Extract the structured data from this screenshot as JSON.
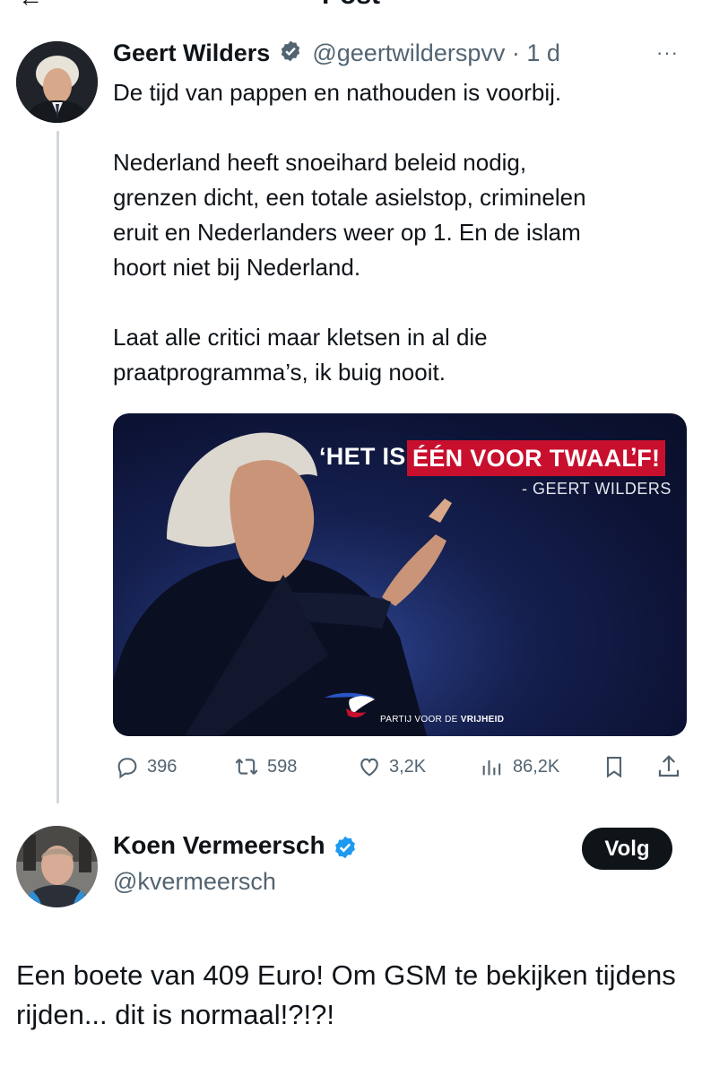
{
  "header": {
    "title": "Post"
  },
  "tweet": {
    "author_name": "Geert Wilders",
    "handle": "@geertwilderspvv",
    "separator": "·",
    "time": "1 d",
    "more": "···",
    "lines": [
      "De tijd van pappen en nathouden is voorbij.",
      "",
      "Nederland heeft snoeihard beleid nodig,",
      "grenzen dicht, een totale asielstop, criminelen",
      "eruit en Nederlanders weer op 1. En de islam",
      "hoort niet bij Nederland.",
      "",
      "Laat alle critici maar kletsen in al die",
      "praatprogramma’s, ik buig nooit."
    ],
    "media": {
      "quote_prefix": "‘HET IS",
      "quote_highlight": "ÉÉN VOOR TWAALF!",
      "quote_suffix": "’",
      "quote_author": "- GEERT WILDERS",
      "party_prefix": "PARTIJ VOOR DE",
      "party_bold": "VRIJHEID",
      "highlight_color": "#c8102e"
    },
    "actions": {
      "replies": "396",
      "reposts": "598",
      "likes": "3,2K",
      "views": "86,2K"
    }
  },
  "reply": {
    "author_name": "Koen Vermeersch",
    "handle": "@kvermeersch",
    "follow_label": "Volg",
    "body": "Een boete van 409 Euro! Om GSM te bekijken tijdens rijden... dit is normaal!?!?!"
  },
  "colors": {
    "verified": "#1d9bf0",
    "text": "#0f1419",
    "muted": "#536471"
  }
}
